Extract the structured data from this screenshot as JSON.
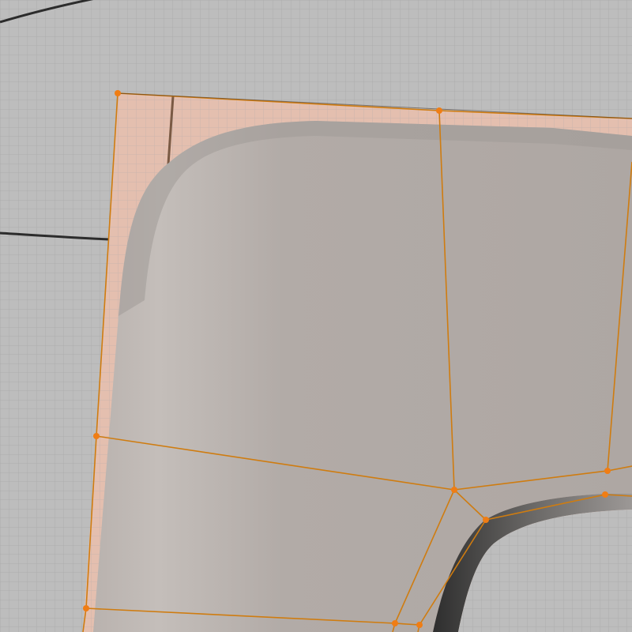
{
  "viewport": {
    "type": "3d-viewport",
    "mode": "edit-mode",
    "background_color": "#bdbdbd",
    "grid_minor_color": "#b0b0b0",
    "grid_major_color": "#a4a4a4"
  },
  "mesh": {
    "selection_fill_color": "#e6bfae",
    "surface_color": "#b2aba6",
    "surface_highlight_color": "#c2bcb8",
    "surface_shadow_color": "#8e8a88",
    "edge_color": "#cf7c10",
    "vertex_color": "#f07d14",
    "selected_vertex_count": 13
  },
  "background_objects": {
    "curve_color": "#2c2c2c"
  }
}
